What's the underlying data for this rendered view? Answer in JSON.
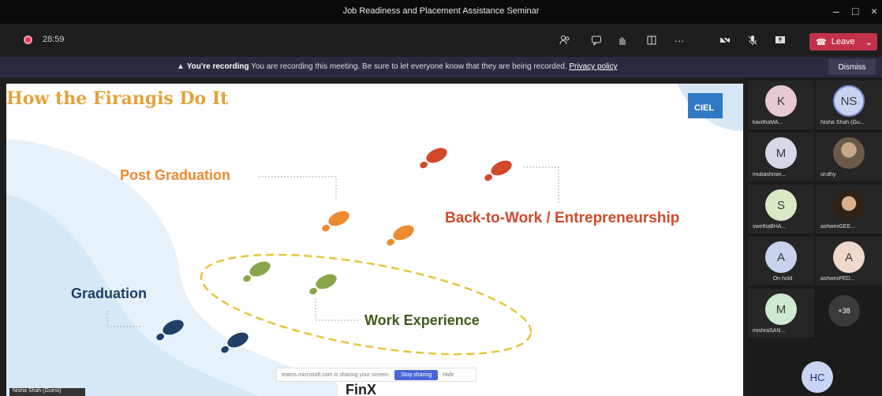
{
  "window": {
    "title": "Job Readiness and Placement Assistance Seminar"
  },
  "toolbar": {
    "timer": "28:59",
    "leave_label": "Leave",
    "more_label": "···"
  },
  "banner": {
    "heading": "You're recording",
    "message": "You are recording this meeting. Be sure to let everyone know that they are being recorded.",
    "link": "Privacy policy",
    "dismiss": "Dismiss"
  },
  "slide": {
    "title": "How the Firangis Do It",
    "logo": "CIEL",
    "labels": {
      "post_graduation": "Post Graduation",
      "back_to_work": "Back-to-Work / Entrepreneurship",
      "graduation": "Graduation",
      "work_experience": "Work Experience"
    },
    "brand": "FinX",
    "presenter": "Nisha Shah (Guest)"
  },
  "sharebar": {
    "message": "teams.microsoft.com is sharing your screen.",
    "stop": "Stop sharing",
    "hide": "Hide"
  },
  "participants": [
    {
      "initials": "K",
      "name": "kavithaMA...",
      "color": "#e8c8d2"
    },
    {
      "initials": "NS",
      "name": "Nisha Shah (Gu...",
      "color": "#c9d3f0"
    },
    {
      "initials": "M",
      "name": "mubashiran...",
      "color": "#d5d8e6"
    },
    {
      "initials": "",
      "name": "oruthy",
      "color": "#6b5a4a"
    },
    {
      "initials": "S",
      "name": "swethaBHA...",
      "color": "#d8e9c4"
    },
    {
      "initials": "",
      "name": "ashwiniGEE...",
      "color": "#5b4638"
    },
    {
      "initials": "A",
      "name": "On hold",
      "color": "#c8d2ef"
    },
    {
      "initials": "A",
      "name": "ashwiniPED...",
      "color": "#efd9cd"
    },
    {
      "initials": "M",
      "name": "mishraSAN...",
      "color": "#cfe8d0"
    }
  ],
  "overflow": "+38",
  "self": {
    "initials": "HC"
  },
  "colors": {
    "leave": "#c4314b",
    "banner": "#2b2b40",
    "title": "#e3a33a",
    "orange": "#ee8a2f",
    "red": "#d2492a",
    "green": "#8aa64a",
    "navy": "#1f3f66"
  }
}
